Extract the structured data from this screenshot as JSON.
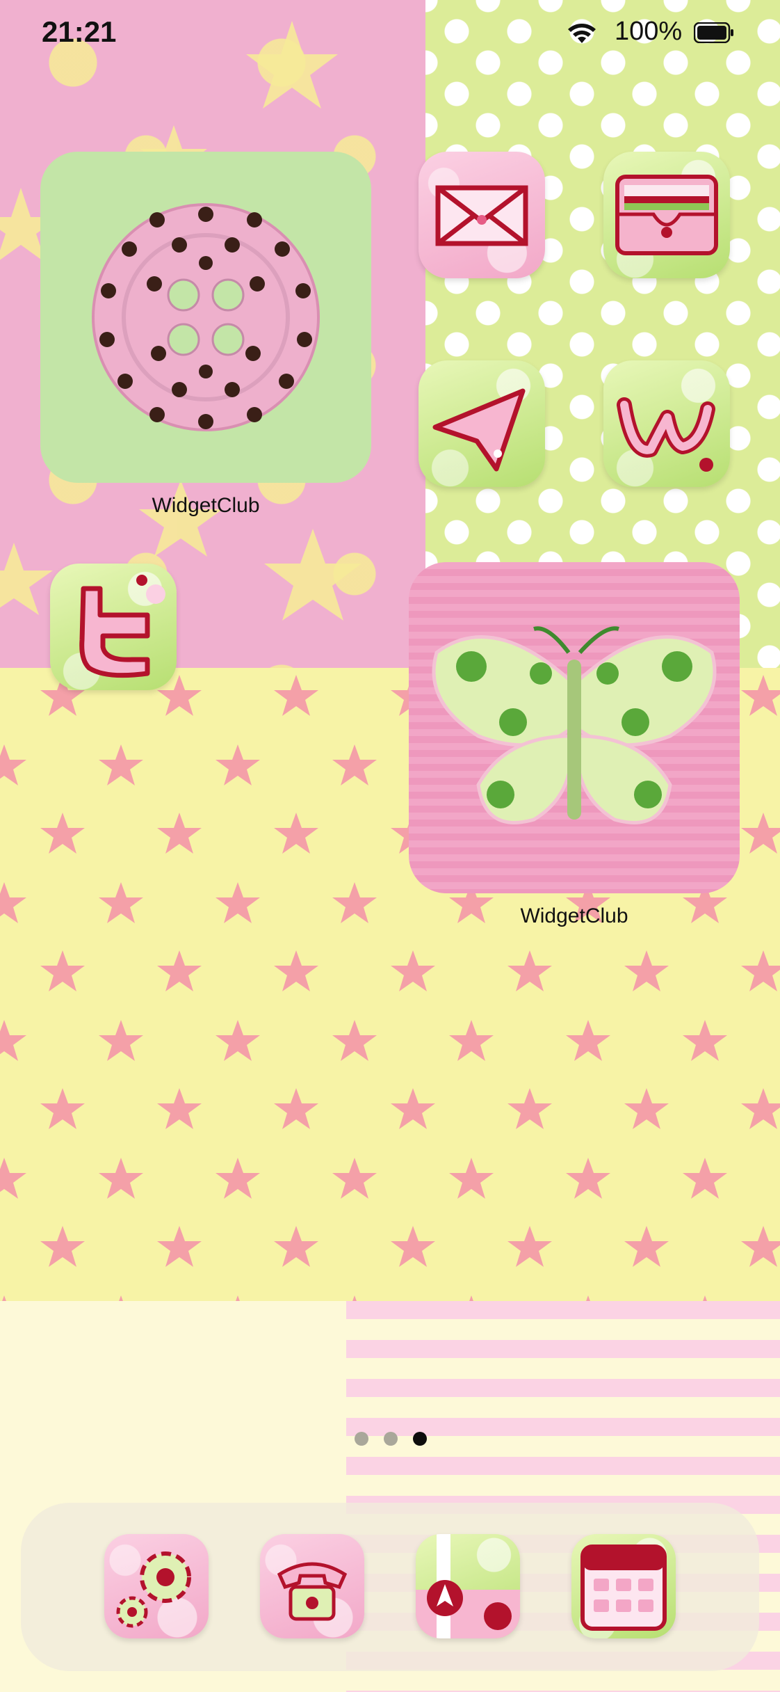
{
  "status_bar": {
    "time": "21:21",
    "battery_percent": "100%",
    "icons": [
      "wifi-icon",
      "battery-icon"
    ]
  },
  "widgets": [
    {
      "id": "button-widget",
      "label": "WidgetClub",
      "image": "pink polka-dot sewing button"
    },
    {
      "id": "butterfly-widget",
      "label": "WidgetClub",
      "image": "embroidered green butterfly on pink stripes"
    }
  ],
  "apps": {
    "mail": "mail-icon",
    "wallet": "wallet-icon",
    "send": "send-icon",
    "widget_app": "w-letter-icon",
    "twitter": "twitter-t-icon"
  },
  "page_indicator": {
    "pages": 3,
    "current": 3
  },
  "dock": [
    "settings-gear-icon",
    "phone-icon",
    "maps-icon",
    "calendar-icon"
  ],
  "colors": {
    "pink": "#f0b0cf",
    "green": "#dcec98",
    "yellow": "#f7f3a6",
    "accent_red": "#b3122c"
  }
}
